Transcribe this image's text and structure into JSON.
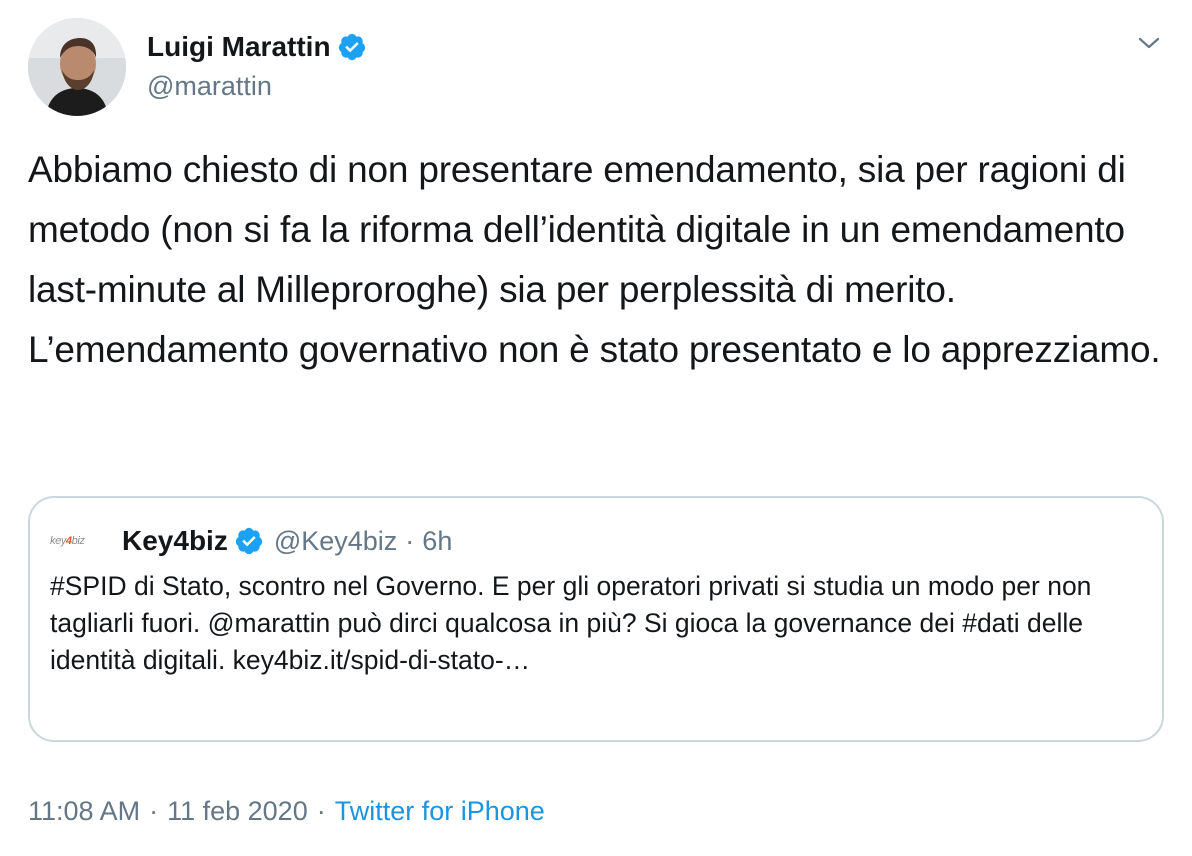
{
  "author": {
    "name": "Luigi Marattin",
    "handle": "@marattin",
    "verified": true,
    "avatar_icon": "person-avatar"
  },
  "tweet": {
    "text": "Abbiamo chiesto di non presentare emendamento, sia per ragioni di metodo (non si fa la riforma dell’identità digitale in un emendamento last-minute al Milleproroghe) sia per perplessità di merito. L’emendamento governativo non è stato presentato e lo apprezziamo."
  },
  "quoted": {
    "logo_text_pre": "key",
    "logo_text_mid": "4",
    "logo_text_post": "biz",
    "name": "Key4biz",
    "handle": "@Key4biz",
    "separator": "·",
    "time": "6h",
    "text": "#SPID di Stato, scontro nel Governo. E per gli operatori privati si studia un modo per non tagliarli fuori. @marattin può dirci qualcosa in più? Si gioca la governance dei #dati delle identità digitali. key4biz.it/spid-di-stato-…"
  },
  "meta": {
    "time": "11:08 AM",
    "separator": "·",
    "date": "11 feb 2020",
    "separator2": "·",
    "source": "Twitter for iPhone"
  },
  "colors": {
    "text": "#14171a",
    "secondary": "#657786",
    "link": "#1b95e0",
    "border": "#ccd6dd",
    "verified": "#1da1f2"
  }
}
